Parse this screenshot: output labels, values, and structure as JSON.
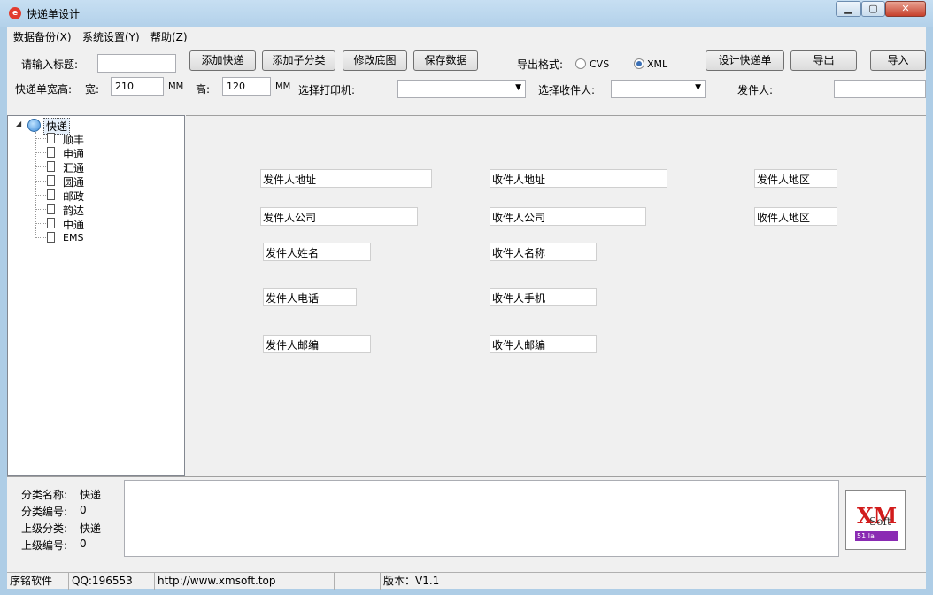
{
  "window": {
    "title": "快递单设计",
    "icon": "app-logo-icon",
    "controls": [
      "minimize-icon",
      "maximize-icon",
      "close-icon"
    ]
  },
  "menu": [
    "数据备份(X)",
    "系统设置(Y)",
    "帮助(Z)"
  ],
  "toolbar": {
    "title_label": "请输入标题:",
    "title_value": "",
    "buttons": [
      "添加快递",
      "添加子分类",
      "修改底图",
      "保存数据"
    ],
    "export_format_label": "导出格式:",
    "format_options": [
      "CVS",
      "XML"
    ],
    "format_selected": "XML",
    "design_button": "设计快递单",
    "export_button": "导出",
    "import_button": "导入"
  },
  "size_row": {
    "size_label": "快递单宽高:",
    "width_label": "宽:",
    "width_value": "210",
    "width_unit": "MM",
    "height_label": "高:",
    "height_value": "120",
    "height_unit": "MM",
    "printer_label": "选择打印机:",
    "printer_value": "",
    "receiver_label": "选择收件人:",
    "receiver_value": "",
    "sender_label": "发件人:",
    "sender_value": ""
  },
  "tree": {
    "root": "快递",
    "children": [
      "顺丰",
      "申通",
      "汇通",
      "圆通",
      "邮政",
      "韵达",
      "中通",
      "EMS"
    ]
  },
  "fields": [
    "发件人地址",
    "收件人地址",
    "发件人地区",
    "发件人公司",
    "收件人公司",
    "收件人地区",
    "发件人姓名",
    "收件人名称",
    "发件人电话",
    "收件人手机",
    "发件人邮编",
    "收件人邮编"
  ],
  "info": {
    "name_label": "分类名称:",
    "name_value": "快递",
    "id_label": "分类编号:",
    "id_value": "0",
    "parent_label": "上级分类:",
    "parent_value": "快递",
    "parent_id_label": "上级编号:",
    "parent_id_value": "0",
    "notes": ""
  },
  "logo": {
    "text": "XM",
    "sub": "Soft",
    "badge": "51.la"
  },
  "status": [
    "序铭软件",
    "QQ:196553",
    "http://www.xmsoft.top",
    "",
    "版本：V1.1"
  ]
}
